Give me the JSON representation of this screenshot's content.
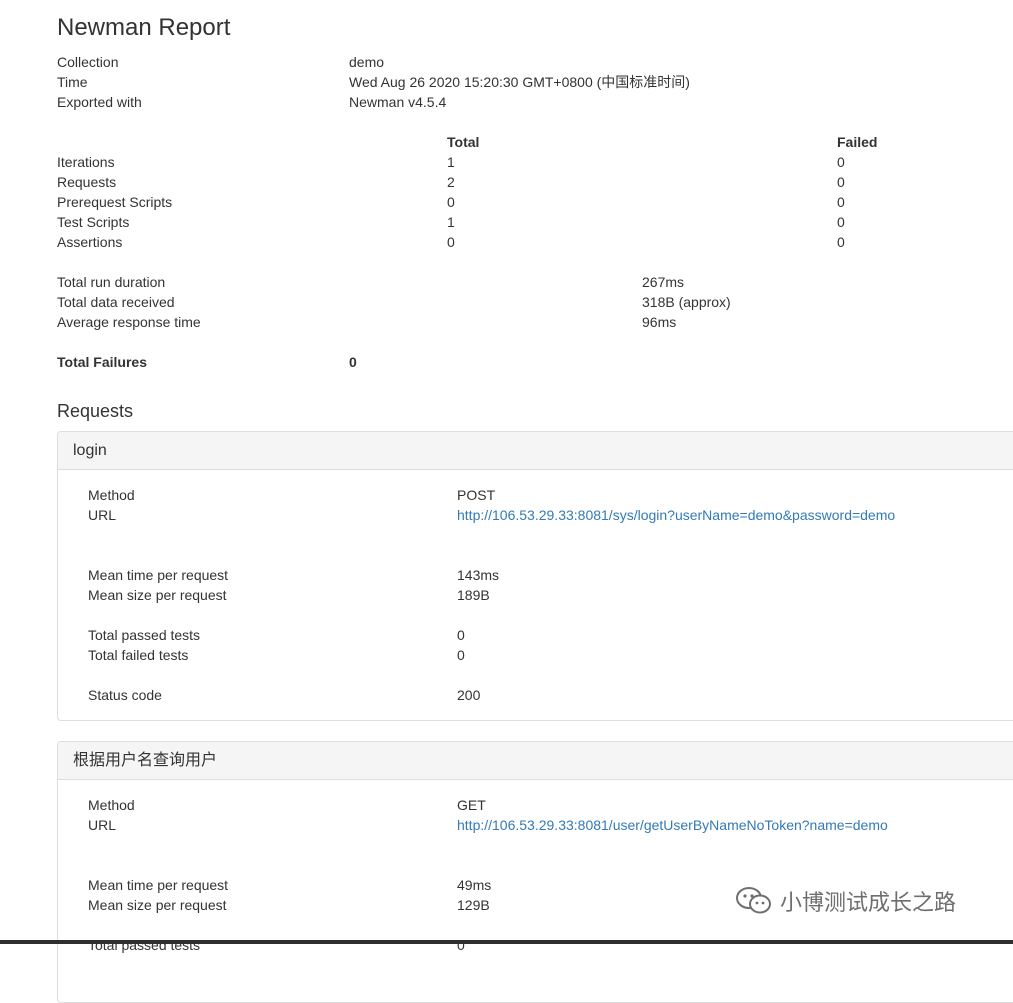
{
  "report": {
    "title": "Newman Report"
  },
  "info": [
    {
      "label": "Collection",
      "value": "demo"
    },
    {
      "label": "Time",
      "value": "Wed Aug 26 2020 15:20:30 GMT+0800 (中国标准时间)"
    },
    {
      "label": "Exported with",
      "value": "Newman v4.5.4"
    }
  ],
  "stats": {
    "headers": {
      "total": "Total",
      "failed": "Failed"
    },
    "rows": [
      {
        "label": "Iterations",
        "total": "1",
        "failed": "0"
      },
      {
        "label": "Requests",
        "total": "2",
        "failed": "0"
      },
      {
        "label": "Prerequest Scripts",
        "total": "0",
        "failed": "0"
      },
      {
        "label": "Test Scripts",
        "total": "1",
        "failed": "0"
      },
      {
        "label": "Assertions",
        "total": "0",
        "failed": "0"
      }
    ]
  },
  "timing": [
    {
      "label": "Total run duration",
      "value": "267ms"
    },
    {
      "label": "Total data received",
      "value": "318B (approx)"
    },
    {
      "label": "Average response time",
      "value": "96ms"
    }
  ],
  "failures": {
    "label": "Total Failures",
    "value": "0"
  },
  "requests_section": {
    "title": "Requests"
  },
  "requests": [
    {
      "name": "login",
      "method_label": "Method",
      "method": "POST",
      "url_label": "URL",
      "url": "http://106.53.29.33:8081/sys/login?userName=demo&password=demo",
      "mean_time_label": "Mean time per request",
      "mean_time": "143ms",
      "mean_size_label": "Mean size per request",
      "mean_size": "189B",
      "passed_label": "Total passed tests",
      "passed": "0",
      "failed_label": "Total failed tests",
      "failed": "0",
      "status_label": "Status code",
      "status": "200"
    },
    {
      "name": "根据用户名查询用户",
      "method_label": "Method",
      "method": "GET",
      "url_label": "URL",
      "url": "http://106.53.29.33:8081/user/getUserByNameNoToken?name=demo",
      "mean_time_label": "Mean time per request",
      "mean_time": "49ms",
      "mean_size_label": "Mean size per request",
      "mean_size": "129B",
      "passed_label": "Total passed tests",
      "passed": "0"
    }
  ],
  "watermark": {
    "text": "小博测试成长之路",
    "icon": "wechat-icon"
  },
  "colors": {
    "link": "#337ab7",
    "panel_heading_bg": "#f5f5f5",
    "border": "#dddddd"
  }
}
